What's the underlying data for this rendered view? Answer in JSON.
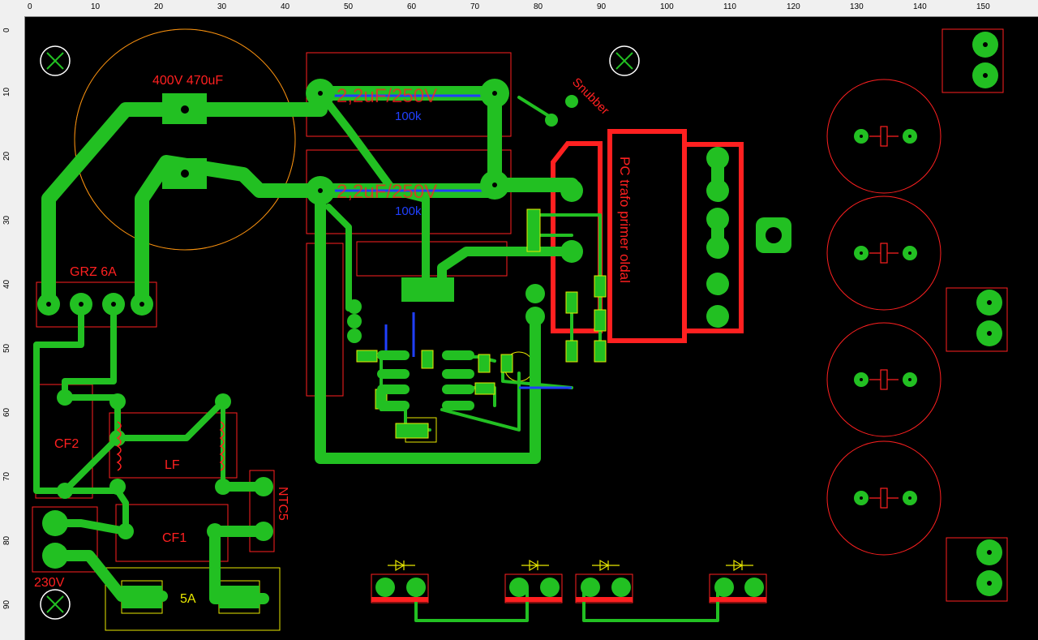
{
  "ruler": {
    "unit": "mm",
    "h_ticks": [
      "0",
      "10",
      "20",
      "30",
      "40",
      "50",
      "60",
      "70",
      "80",
      "90",
      "100",
      "110",
      "120",
      "130",
      "140",
      "150"
    ],
    "v_ticks": [
      "0",
      "10",
      "20",
      "30",
      "40",
      "50",
      "60",
      "70",
      "80",
      "90"
    ]
  },
  "labels": {
    "cap_main": "400V 470uF",
    "cap_film_1": "2,2uF/250V",
    "cap_film_2": "2,2uF/250V",
    "res_1": "100k",
    "res_2": "100k",
    "snubber": "Snubber",
    "bridge": "GRZ 6A",
    "cf2": "CF2",
    "lf": "LF",
    "cf1": "CF1",
    "ntc": "NTC5",
    "fuse": "5A",
    "mains": "230V",
    "transformer": "PC trafo primer oldal"
  },
  "colors": {
    "background": "#000000",
    "copper": "#22c022",
    "silk": "#ff2020",
    "outline": "#e8e800",
    "blue": "#2040ff",
    "drill": "#000000"
  }
}
